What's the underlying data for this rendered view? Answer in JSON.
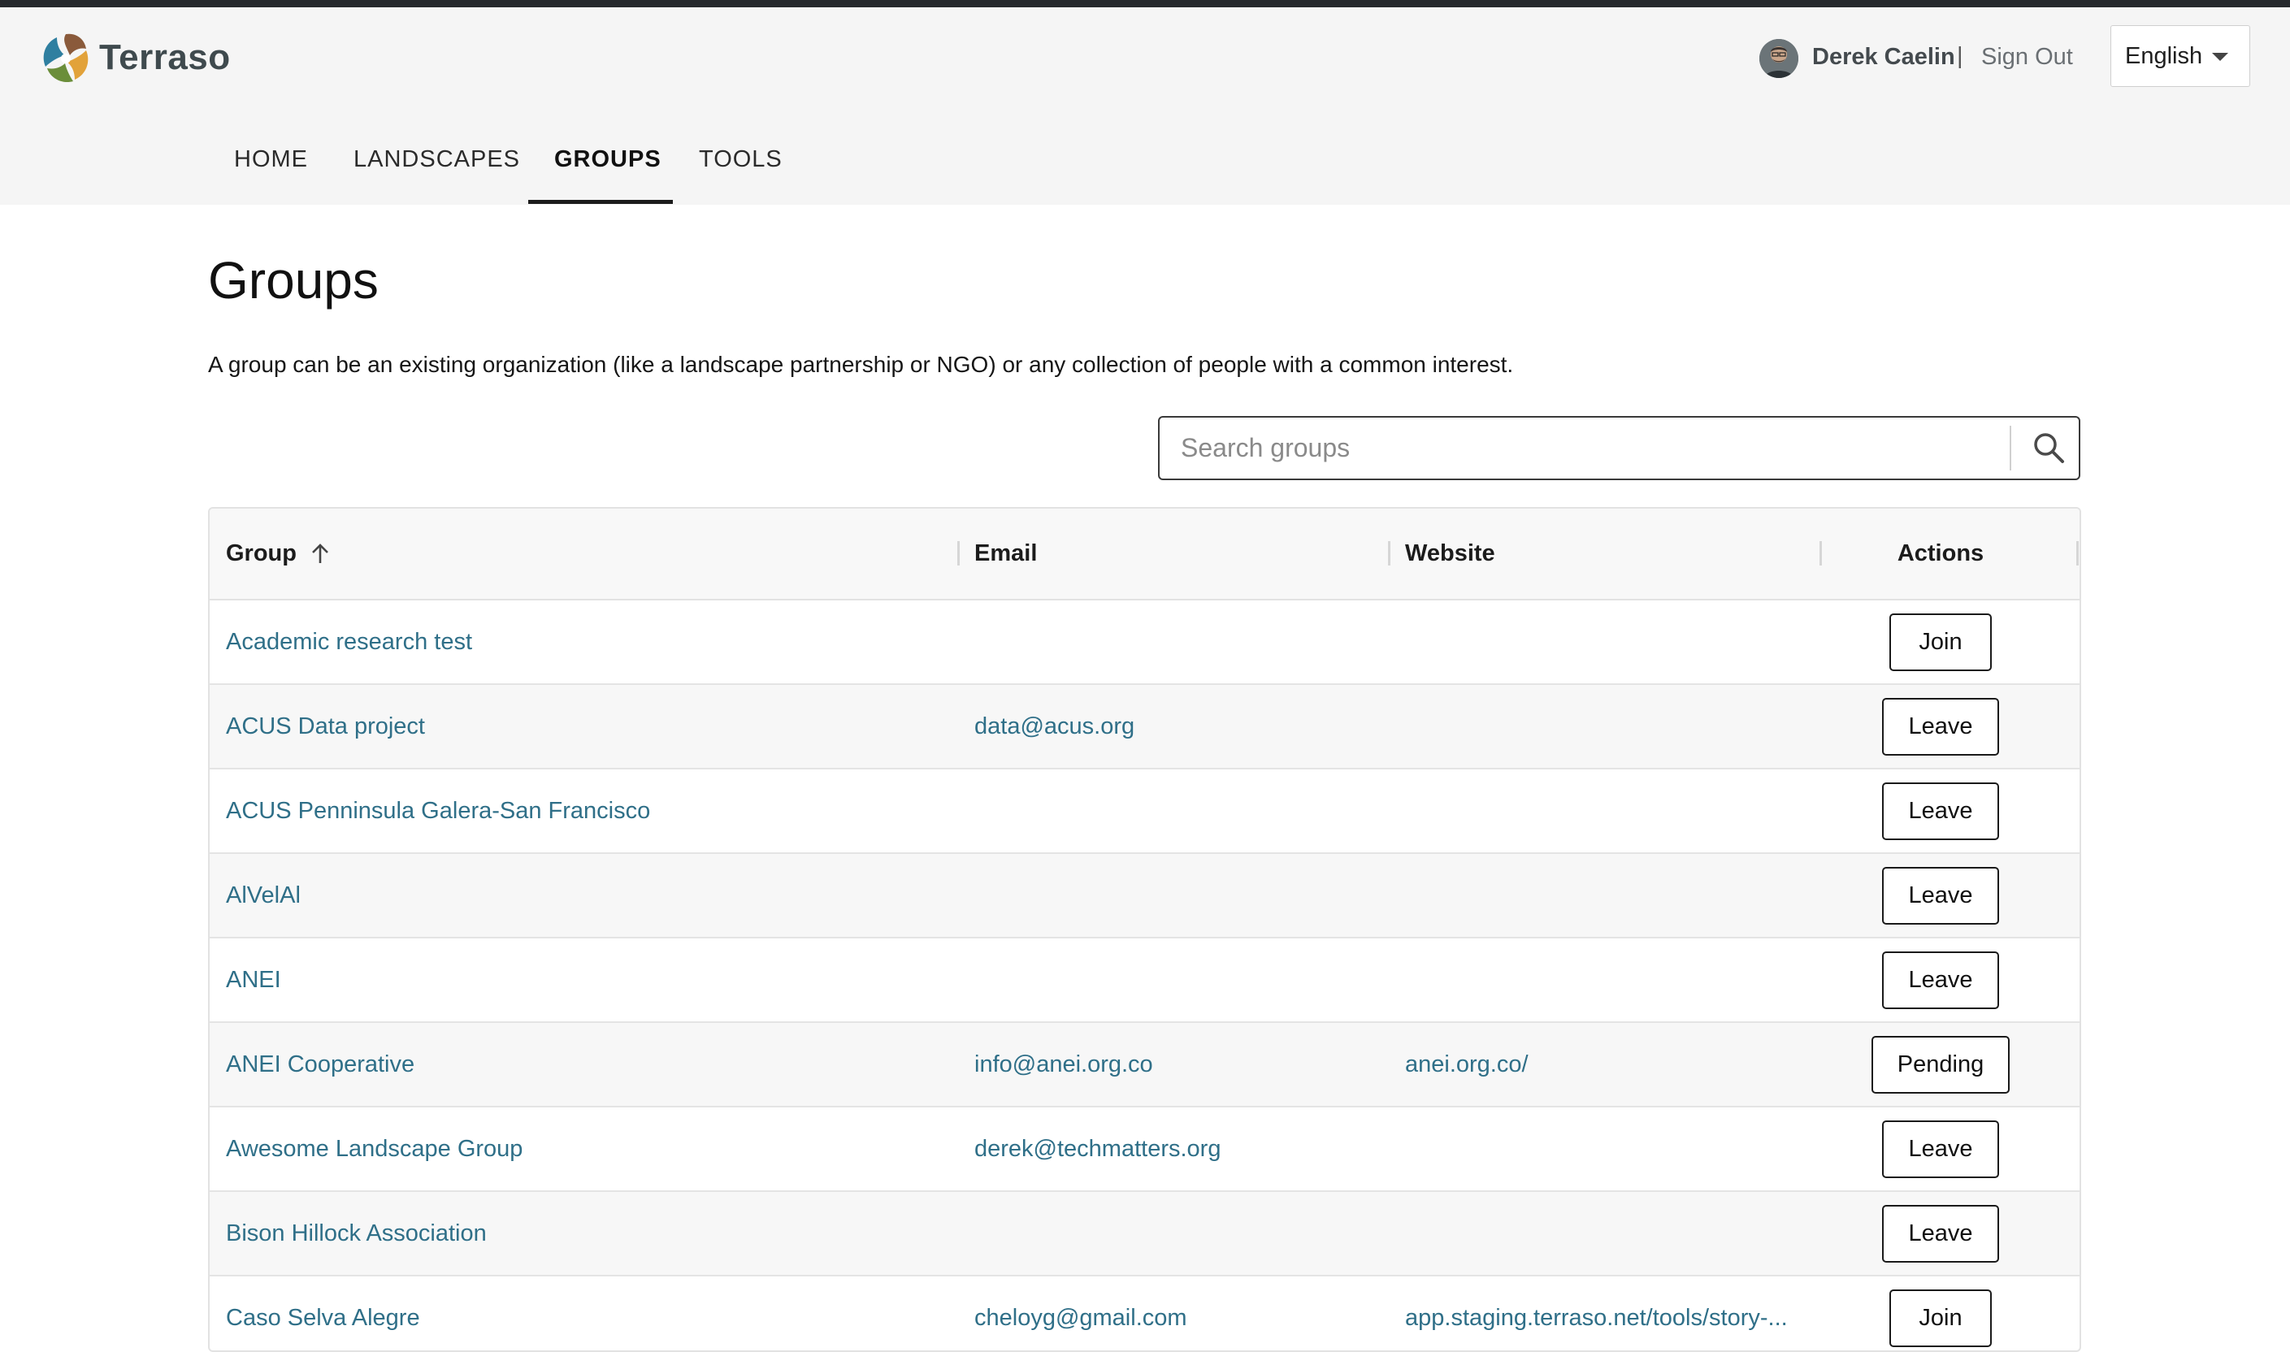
{
  "brand": {
    "name": "Terraso"
  },
  "user": {
    "name": "Derek Caelin",
    "separator": "|",
    "sign_out": "Sign Out"
  },
  "language": {
    "selected": "English"
  },
  "nav": {
    "tabs": [
      {
        "label": "HOME"
      },
      {
        "label": "LANDSCAPES"
      },
      {
        "label": "GROUPS"
      },
      {
        "label": "TOOLS"
      }
    ],
    "active": "GROUPS"
  },
  "page": {
    "title": "Groups",
    "intro": "A group can be an existing organization (like a landscape partnership or NGO) or any collection of people with a common interest."
  },
  "search": {
    "placeholder": "Search groups",
    "value": ""
  },
  "table": {
    "headers": {
      "group": "Group",
      "email": "Email",
      "website": "Website",
      "actions": "Actions"
    },
    "sort": "ascending",
    "rows": [
      {
        "group": "Academic research test",
        "email": "",
        "website": "",
        "action": "Join"
      },
      {
        "group": "ACUS Data project",
        "email": "data@acus.org",
        "website": "",
        "action": "Leave"
      },
      {
        "group": "ACUS Penninsula Galera-San Francisco",
        "email": "",
        "website": "",
        "action": "Leave"
      },
      {
        "group": "AlVelAl",
        "email": "",
        "website": "",
        "action": "Leave"
      },
      {
        "group": "ANEI",
        "email": "",
        "website": "",
        "action": "Leave"
      },
      {
        "group": "ANEI Cooperative",
        "email": "info@anei.org.co",
        "website": "anei.org.co/",
        "action": "Pending"
      },
      {
        "group": "Awesome Landscape Group",
        "email": "derek@techmatters.org",
        "website": "",
        "action": "Leave"
      },
      {
        "group": "Bison Hillock Association",
        "email": "",
        "website": "",
        "action": "Leave"
      },
      {
        "group": "Caso Selva Alegre",
        "email": "cheloyg@gmail.com",
        "website": "app.staging.terraso.net/tools/story-...",
        "action": "Join"
      }
    ]
  },
  "colors": {
    "link": "#2f6f88",
    "header_band": "#f5f5f5",
    "top_strip": "#26292d"
  }
}
